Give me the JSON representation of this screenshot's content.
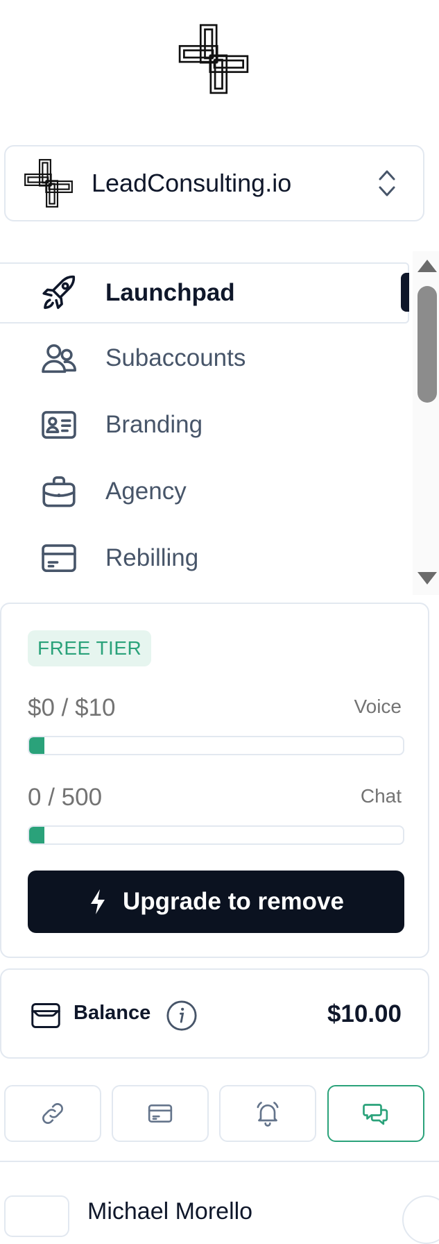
{
  "brand": {
    "logo_icon": "interlaced-knot-logo"
  },
  "account_switcher": {
    "name": "LeadConsulting.io",
    "logo_icon": "interlaced-knot-logo",
    "chevron_icon": "chevron-up-down-icon"
  },
  "nav": {
    "items": [
      {
        "label": "Launchpad",
        "icon": "rocket-icon",
        "active": true
      },
      {
        "label": "Subaccounts",
        "icon": "users-icon",
        "active": false
      },
      {
        "label": "Branding",
        "icon": "id-card-icon",
        "active": false
      },
      {
        "label": "Agency",
        "icon": "briefcase-icon",
        "active": false
      },
      {
        "label": "Rebilling",
        "icon": "credit-card-icon",
        "active": false
      }
    ]
  },
  "plan": {
    "badge": "FREE TIER",
    "voice": {
      "value": "$0 / $10",
      "label": "Voice",
      "progress_fraction": 0.04
    },
    "chat": {
      "value": "0 / 500",
      "label": "Chat",
      "progress_fraction": 0.04
    },
    "upgrade_label": "Upgrade to remove",
    "upgrade_icon": "lightning-bolt-icon"
  },
  "balance": {
    "label": "Balance",
    "value": "$10.00",
    "wallet_icon": "wallet-icon",
    "info_icon": "info-icon"
  },
  "quick_actions": [
    {
      "icon": "link-icon",
      "selected": false
    },
    {
      "icon": "credit-card-icon",
      "selected": false
    },
    {
      "icon": "alarm-bell-icon",
      "selected": false
    },
    {
      "icon": "chat-bubbles-icon",
      "selected": true
    }
  ],
  "user": {
    "name": "Michael Morello"
  },
  "colors": {
    "accent_green": "#2aa27a",
    "dark": "#0b1220",
    "border": "#e2e8f0",
    "badge_bg": "#e6f5ef"
  }
}
